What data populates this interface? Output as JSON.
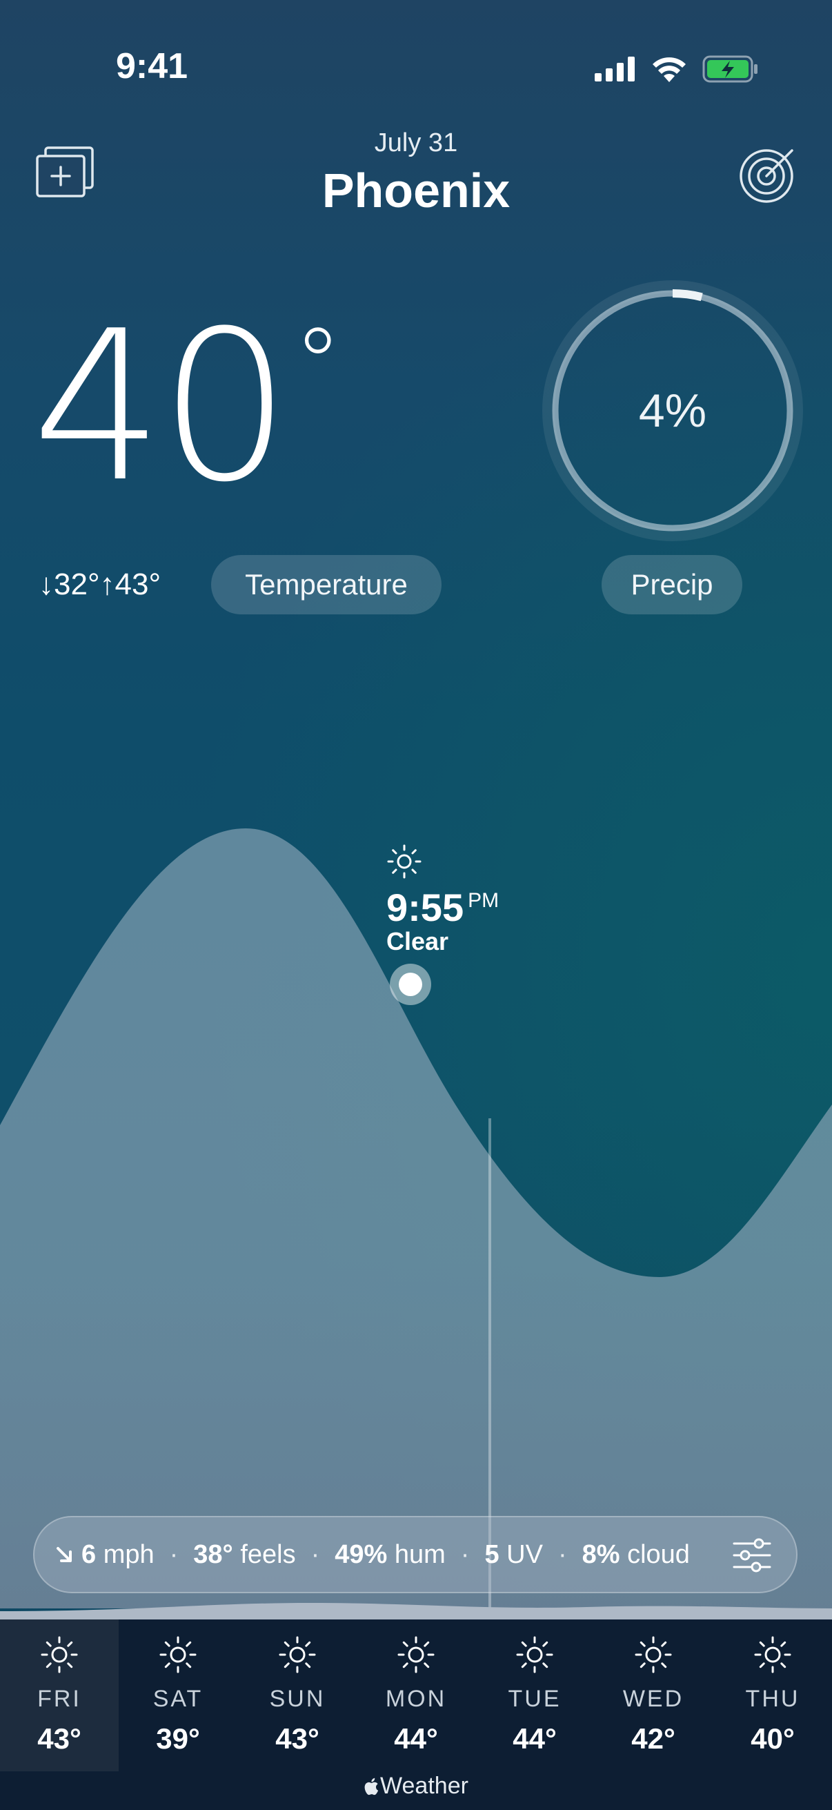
{
  "status_bar": {
    "time": "9:41"
  },
  "header": {
    "date": "July 31",
    "city": "Phoenix"
  },
  "current": {
    "temperature": "40",
    "degree_symbol": "°",
    "low_high": "↓32°↑43°",
    "temperature_button": "Temperature"
  },
  "precip": {
    "value": "4%",
    "fraction": 0.04,
    "button": "Precip"
  },
  "tooltip": {
    "time": "9:55",
    "ampm": "PM",
    "condition": "Clear",
    "icon": "sun-icon"
  },
  "info_bar": {
    "wind_value": "6",
    "wind_unit": "mph",
    "feels_value": "38°",
    "feels_unit": "feels",
    "hum_value": "49%",
    "hum_unit": "hum",
    "uv_value": "5",
    "uv_unit": "UV",
    "cloud_value": "8%",
    "cloud_unit": "cloud",
    "separator": "·"
  },
  "forecast": [
    {
      "day": "FRI",
      "temp": "43°",
      "icon": "sun-icon",
      "selected": true
    },
    {
      "day": "SAT",
      "temp": "39°",
      "icon": "sun-icon"
    },
    {
      "day": "SUN",
      "temp": "43°",
      "icon": "sun-icon"
    },
    {
      "day": "MON",
      "temp": "44°",
      "icon": "sun-icon"
    },
    {
      "day": "TUE",
      "temp": "44°",
      "icon": "sun-icon"
    },
    {
      "day": "WED",
      "temp": "42°",
      "icon": "sun-icon"
    },
    {
      "day": "THU",
      "temp": "40°",
      "icon": "sun-icon"
    }
  ],
  "brand": {
    "label": "Weather"
  },
  "colors": {
    "background_top": "#1f4463",
    "background_mid": "#0f4d6a",
    "forecast_bg": "#0d1e33",
    "battery": "#34c759"
  }
}
